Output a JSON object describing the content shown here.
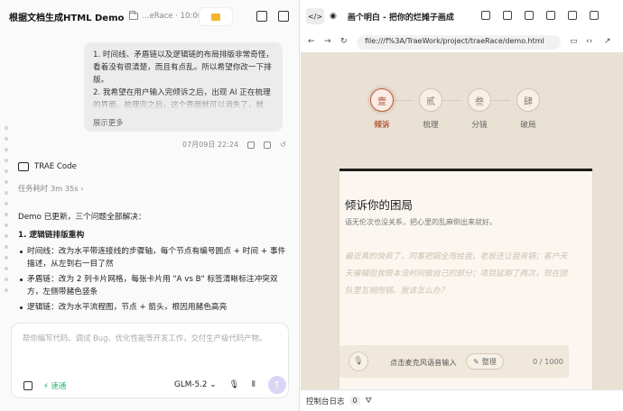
{
  "left": {
    "title": "根据文档生成HTML Demo",
    "breadcrumb": "...eRace · 10:00",
    "user_message": "1. 时间线、矛盾链以及逻辑链的布局排版非常奇怪，看着没有很清楚，而且有点乱。所以希望你改一下排版。\n2. 我希望在用户输入完倾诉之后，出现 AI 正在梳理的界面。梳理完之后，这个界面就可以消失了，就",
    "show_more": "展示更多",
    "timestamp": "07月09日 22:24",
    "agent_name": "TRAE Code",
    "elapsed": "任务耗时 3m 35s ›",
    "reply_intro": "Demo 已更新，三个问题全部解决：",
    "reply_heading": "1. 逻辑链排版重构",
    "reply_items": [
      "时间线：改为水平带连接线的步骤轴，每个节点有编号圆点 + 时间 + 事件描述，从左到右一目了然",
      "矛盾链：改为 2 列卡片网格，每张卡片用 \"A vs B\" 标签清晰标注冲突双方，左侧带赭色竖条",
      "逻辑链：改为水平流程图，节点 + 箭头，根因用赭色高亮"
    ],
    "input_placeholder": "帮你编写代码、调试 Bug、优化性能等开发工作，交付生产级代码产物。",
    "fast_label": "⚡ 速通",
    "model": "GLM-5.2 ⌄"
  },
  "right": {
    "tab_title": "画个明白 - 把你的烂摊子画成漫...",
    "url": "file:///f%3A/TraeWork/project/traeRace/demo.html",
    "steps": [
      {
        "num": "壹",
        "label": "倾诉"
      },
      {
        "num": "贰",
        "label": "梳理"
      },
      {
        "num": "叁",
        "label": "分镜"
      },
      {
        "num": "肆",
        "label": "破局"
      }
    ],
    "card_title": "倾诉你的困局",
    "card_subtitle": "语无伦次也没关系，把心里的乱麻倒出来就好。",
    "card_placeholder": "最近真的快疯了，同事把锅全甩给我，老板还让我背锅；客户天天催稿但我根本没时间做自己的部分；项目延期了两次，现在团队里互相甩锅。我该怎么办？",
    "voice_hint": "点击麦克风语音输入",
    "tidy_label": "整理",
    "char_count": "0 / 1000",
    "console_label": "控制台日志",
    "console_count": "0"
  }
}
